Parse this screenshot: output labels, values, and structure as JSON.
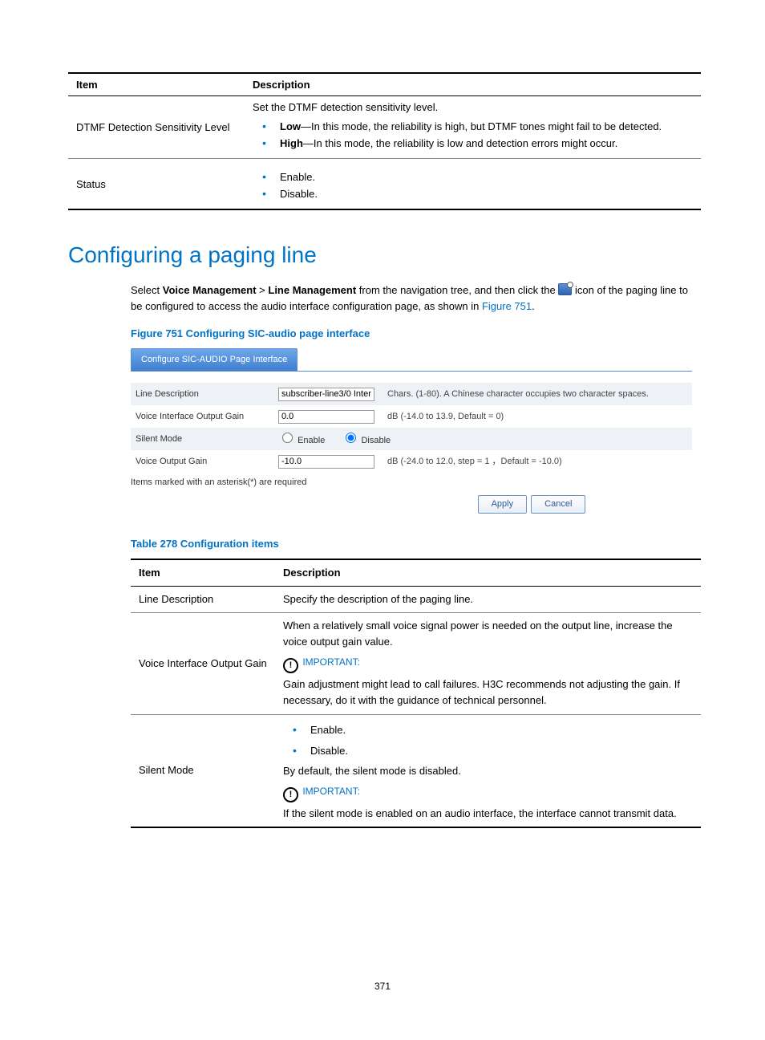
{
  "table_top": {
    "headers": {
      "item": "Item",
      "desc": "Description"
    },
    "row1": {
      "item": "DTMF Detection Sensitivity Level",
      "intro": "Set the DTMF detection sensitivity level.",
      "b1_bold": "Low",
      "b1_rest": "—In this mode, the reliability is high, but DTMF tones might fail to be detected.",
      "b2_bold": "High",
      "b2_rest": "—In this mode, the reliability is low and detection errors might occur."
    },
    "row2": {
      "item": "Status",
      "b1": "Enable.",
      "b2": "Disable."
    }
  },
  "heading": "Configuring a paging line",
  "para": {
    "p1a": "Select ",
    "p1b": "Voice Management",
    "p1c": " > ",
    "p1d": "Line Management",
    "p1e": " from the navigation tree, and then click the ",
    "p1f": " icon of the paging line to be configured to access the audio interface configuration page, as shown in ",
    "link": "Figure 751",
    "p1g": "."
  },
  "figure_caption": "Figure 751 Configuring SIC-audio page interface",
  "shot": {
    "tab": "Configure SIC-AUDIO Page Interface",
    "r1": {
      "label": "Line Description",
      "value": "subscriber-line3/0 Inter",
      "hint": "Chars. (1-80). A Chinese character occupies two character spaces."
    },
    "r2": {
      "label": "Voice Interface Output Gain",
      "value": "0.0",
      "hint": "dB (-14.0 to 13.9, Default = 0)"
    },
    "r3": {
      "label": "Silent Mode",
      "opt1": "Enable",
      "opt2": "Disable"
    },
    "r4": {
      "label": "Voice Output Gain",
      "value": "-10.0",
      "hint": "dB (-24.0 to 12.0, step = 1 ，Default = -10.0)"
    },
    "required": "Items marked with an asterisk(*) are required",
    "apply": "Apply",
    "cancel": "Cancel"
  },
  "table_caption": "Table 278 Configuration items",
  "table2": {
    "headers": {
      "item": "Item",
      "desc": "Description"
    },
    "row1": {
      "item": "Line Description",
      "desc": "Specify the description of the paging line."
    },
    "row2": {
      "item": "Voice Interface Output Gain",
      "p1": "When a relatively small voice signal power is needed on the output line, increase the voice output gain value.",
      "imp": "IMPORTANT:",
      "p2": "Gain adjustment might lead to call failures. H3C recommends not adjusting the gain. If necessary, do it with the guidance of technical personnel."
    },
    "row3": {
      "item": "Silent Mode",
      "b1": "Enable.",
      "b2": "Disable.",
      "p1": "By default, the silent mode is disabled.",
      "imp": "IMPORTANT:",
      "p2": "If the silent mode is enabled on an audio interface, the interface cannot transmit data."
    }
  },
  "page_number": "371"
}
